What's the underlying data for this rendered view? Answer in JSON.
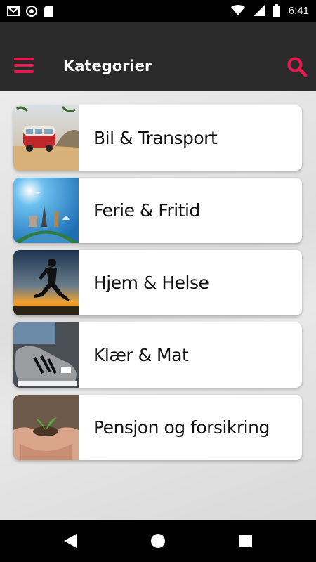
{
  "status_bar": {
    "time": "6:41",
    "icons": [
      "gmail-icon",
      "sync-icon",
      "sd-card-icon",
      "wifi-icon",
      "signal-icon",
      "battery-icon"
    ]
  },
  "app_bar": {
    "title": "Kategorier",
    "menu_icon": "hamburger-menu-icon",
    "search_icon": "search-icon",
    "accent_color": "#e8194f",
    "background_color": "#2a2a2a"
  },
  "categories": [
    {
      "label": "Bil & Transport",
      "image": "vw-van-on-beach"
    },
    {
      "label": "Ferie & Fritid",
      "image": "world-landmarks-globe"
    },
    {
      "label": "Hjem & Helse",
      "image": "runner-at-sunset"
    },
    {
      "label": "Klær & Mat",
      "image": "sneakers"
    },
    {
      "label": "Pensjon og forsikring",
      "image": "hands-holding-plant"
    }
  ],
  "nav_bar": {
    "icons": [
      "back-icon",
      "home-icon",
      "recents-icon"
    ]
  }
}
